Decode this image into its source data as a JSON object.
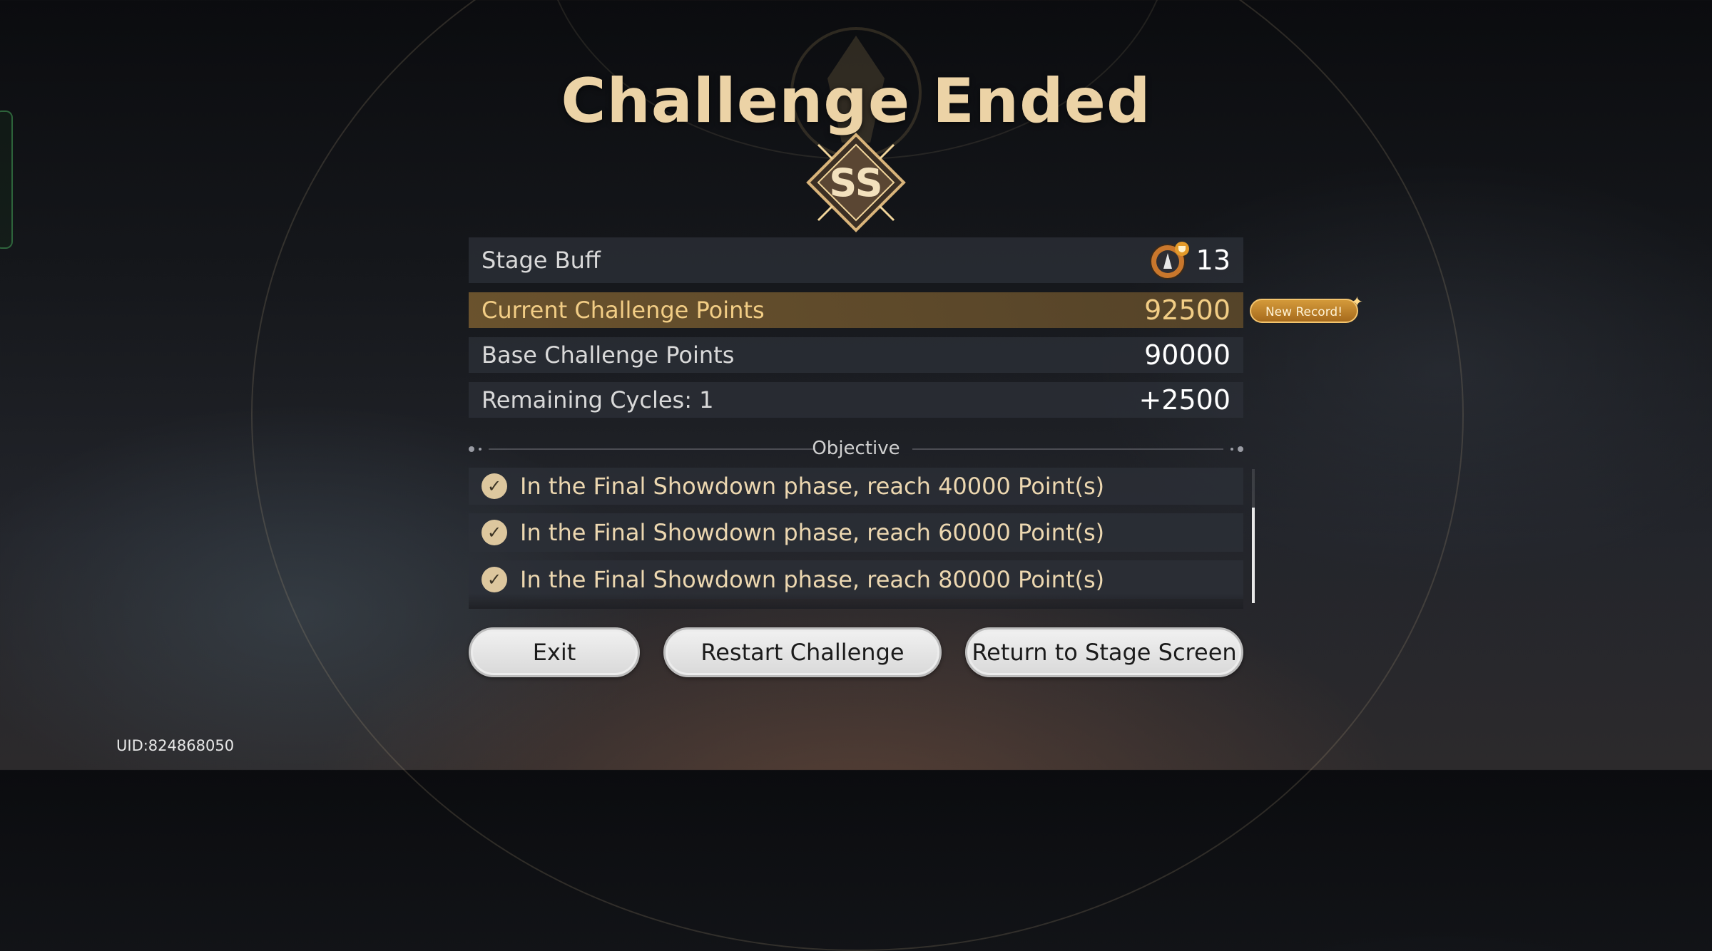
{
  "header": {
    "title": "Challenge Ended",
    "rank": "SS"
  },
  "summary": {
    "stage_buff": {
      "label": "Stage Buff",
      "value": "13",
      "icon": "buff-trophy-icon"
    },
    "current_points": {
      "label": "Current Challenge Points",
      "value": "92500",
      "badge": "New Record!"
    },
    "base_points": {
      "label": "Base Challenge Points",
      "value": "90000"
    },
    "remaining_cycles": {
      "label": "Remaining Cycles: 1",
      "value": "+2500"
    }
  },
  "objective": {
    "title": "Objective",
    "items": [
      {
        "text": "In the Final Showdown phase, reach 40000 Point(s)",
        "done": true
      },
      {
        "text": "In the Final Showdown phase, reach 60000 Point(s)",
        "done": true
      },
      {
        "text": "In the Final Showdown phase, reach 80000 Point(s)",
        "done": true
      }
    ]
  },
  "buttons": {
    "exit": "Exit",
    "restart": "Restart Challenge",
    "return": "Return to Stage Screen"
  },
  "footer": {
    "uid": "UID:824868050"
  },
  "colors": {
    "accent_gold": "#ecd3a6",
    "highlight_text": "#f2cd85"
  }
}
